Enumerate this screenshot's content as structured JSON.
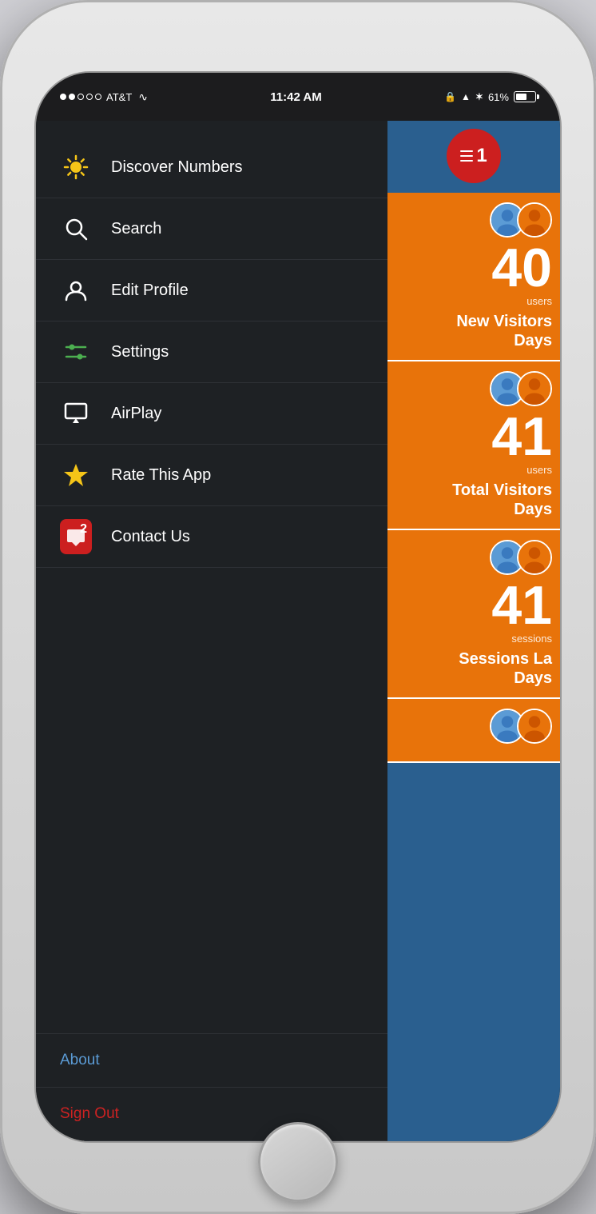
{
  "phone": {
    "status_bar": {
      "carrier": "AT&T",
      "time": "11:42 AM",
      "battery_percent": "61%"
    }
  },
  "menu": {
    "items": [
      {
        "id": "discover",
        "label": "Discover Numbers",
        "icon": "sun-icon"
      },
      {
        "id": "search",
        "label": "Search",
        "icon": "search-icon"
      },
      {
        "id": "edit-profile",
        "label": "Edit Profile",
        "icon": "person-icon"
      },
      {
        "id": "settings",
        "label": "Settings",
        "icon": "sliders-icon"
      },
      {
        "id": "airplay",
        "label": "AirPlay",
        "icon": "airplay-icon"
      },
      {
        "id": "rate-app",
        "label": "Rate This App",
        "icon": "star-icon"
      },
      {
        "id": "contact-us",
        "label": "Contact Us",
        "icon": "contact-badge"
      }
    ],
    "bottom": {
      "about_label": "About",
      "signout_label": "Sign Out"
    }
  },
  "right_panel": {
    "notification_count": "1",
    "stats": [
      {
        "number": "40",
        "unit": "users",
        "description": "New Visitors\nDays"
      },
      {
        "number": "41",
        "unit": "users",
        "description": "Total Visitors\nDays"
      },
      {
        "number": "41",
        "unit": "sessions",
        "description": "Sessions La\nDays"
      },
      {
        "number": "",
        "unit": "",
        "description": ""
      }
    ]
  }
}
